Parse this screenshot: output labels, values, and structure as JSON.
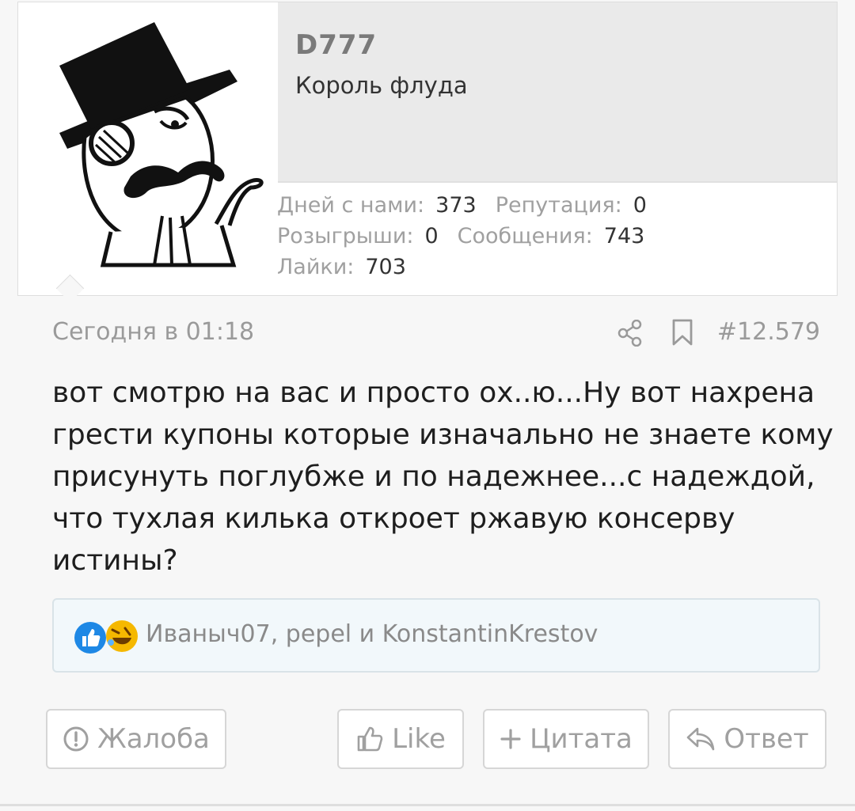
{
  "user": {
    "name": "D777",
    "title": "Король флуда"
  },
  "stats": {
    "days_label": "Дней с нами:",
    "days_value": "373",
    "rep_label": "Репутация:",
    "rep_value": "0",
    "raffles_label": "Розыгрыши:",
    "raffles_value": "0",
    "messages_label": "Сообщения:",
    "messages_value": "743",
    "likes_label": "Лайки:",
    "likes_value": "703"
  },
  "post": {
    "date": "Сегодня в 01:18",
    "number": "#12.579",
    "body": "вот смотрю на вас и просто ох..ю...Ну вот нахрена грести купоны которые изначально не знаете кому присунуть поглубже и по надежнее...с надеждой, что тухлая килька откроет ржавую консерву истины?"
  },
  "reactions": {
    "icons": [
      "like-reaction-icon",
      "laugh-reaction-icon"
    ],
    "text": "Иваныч07, pepel и KonstantinKrestov"
  },
  "actions": {
    "report": "Жалоба",
    "like": "Like",
    "quote": "Цитата",
    "reply": "Ответ"
  },
  "colors": {
    "like_blue": "#1e88e5",
    "laugh_yellow": "#f5b800",
    "text_dark": "#1e1e1e",
    "text_muted": "#9a9a9a"
  }
}
